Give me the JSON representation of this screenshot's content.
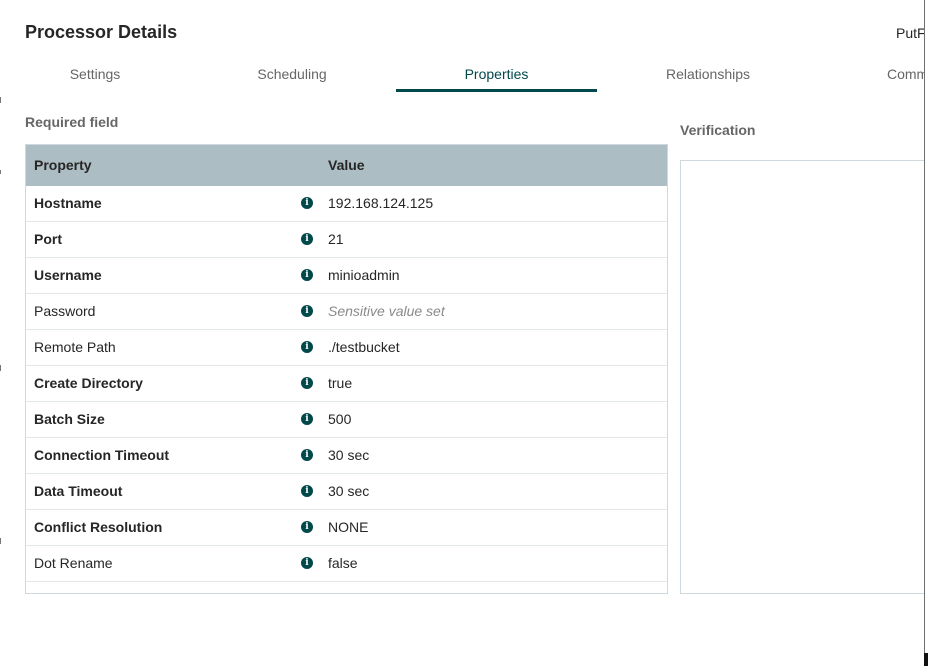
{
  "dialog": {
    "title": "Processor Details",
    "processor_type": "PutF"
  },
  "tabs": [
    {
      "label": "Settings",
      "active": false
    },
    {
      "label": "Scheduling",
      "active": false
    },
    {
      "label": "Properties",
      "active": true
    },
    {
      "label": "Relationships",
      "active": false
    },
    {
      "label": "Comm",
      "active": false
    }
  ],
  "properties": {
    "required_label": "Required field",
    "headers": {
      "property": "Property",
      "value": "Value"
    },
    "rows": [
      {
        "name": "Hostname",
        "required": true,
        "value": "192.168.124.125",
        "sensitive": false
      },
      {
        "name": "Port",
        "required": true,
        "value": "21",
        "sensitive": false
      },
      {
        "name": "Username",
        "required": true,
        "value": "minioadmin",
        "sensitive": false
      },
      {
        "name": "Password",
        "required": false,
        "value": "Sensitive value set",
        "sensitive": true
      },
      {
        "name": "Remote Path",
        "required": false,
        "value": "./testbucket",
        "sensitive": false
      },
      {
        "name": "Create Directory",
        "required": true,
        "value": "true",
        "sensitive": false
      },
      {
        "name": "Batch Size",
        "required": true,
        "value": "500",
        "sensitive": false
      },
      {
        "name": "Connection Timeout",
        "required": true,
        "value": "30 sec",
        "sensitive": false
      },
      {
        "name": "Data Timeout",
        "required": true,
        "value": "30 sec",
        "sensitive": false
      },
      {
        "name": "Conflict Resolution",
        "required": true,
        "value": "NONE",
        "sensitive": false
      },
      {
        "name": "Dot Rename",
        "required": false,
        "value": "false",
        "sensitive": false
      }
    ],
    "info_icon": "info-circle-icon",
    "info_glyph": "i"
  },
  "verification": {
    "label": "Verification"
  },
  "colors": {
    "accent": "#004849",
    "header_bg": "#acbdc3",
    "muted_text": "#666666"
  }
}
